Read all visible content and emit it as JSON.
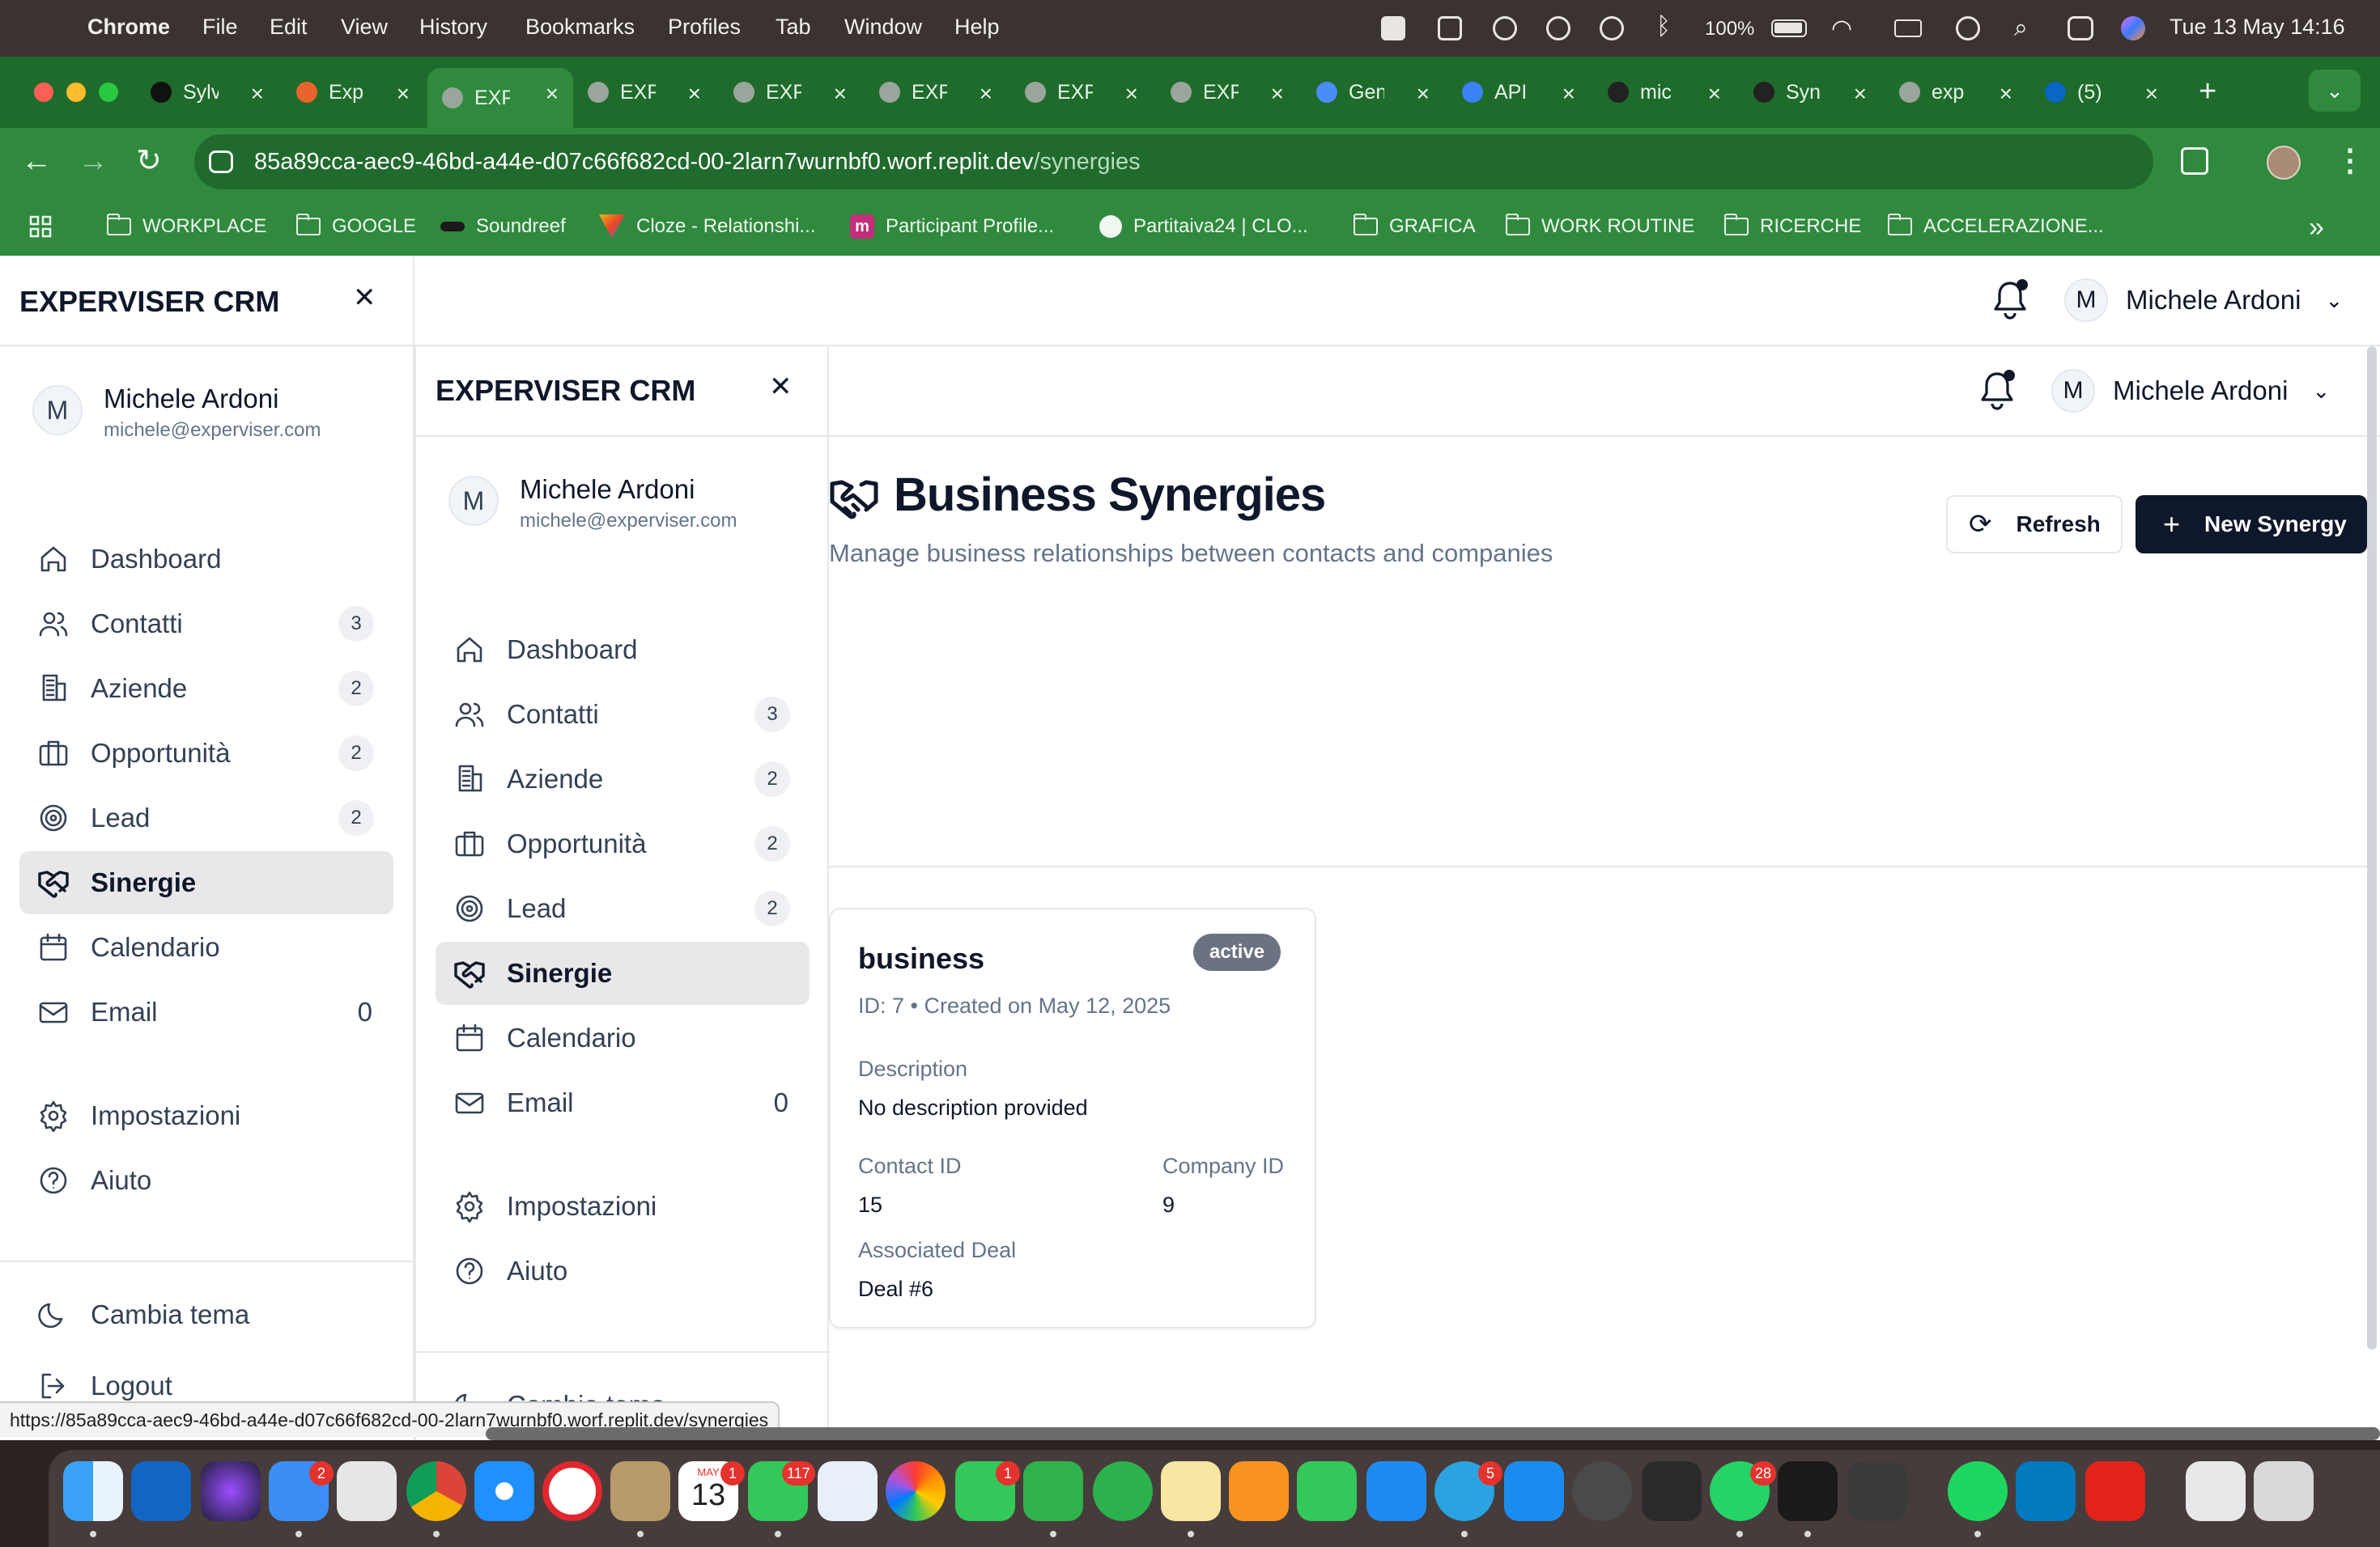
{
  "menubar": {
    "app": "Chrome",
    "menus": [
      "File",
      "Edit",
      "View",
      "History",
      "Bookmarks",
      "Profiles",
      "Tab",
      "Window",
      "Help"
    ],
    "battery": "100%",
    "clock": "Tue 13 May  14:16"
  },
  "tabs": [
    {
      "label": "Sylv",
      "color": "#111111"
    },
    {
      "label": "Exp",
      "color": "#e8642c"
    },
    {
      "label": "EXP",
      "color": "#9aa59c"
    },
    {
      "label": "EXP",
      "color": "#9aa59c"
    },
    {
      "label": "EXP",
      "color": "#9aa59c"
    },
    {
      "label": "EXP",
      "color": "#9aa59c"
    },
    {
      "label": "EXP",
      "color": "#9aa59c"
    },
    {
      "label": "EXP",
      "color": "#9aa59c"
    },
    {
      "label": "Gen",
      "color": "#4b8df8"
    },
    {
      "label": "API",
      "color": "#3b82f6"
    },
    {
      "label": "mic",
      "color": "#222222"
    },
    {
      "label": "Syn",
      "color": "#222222"
    },
    {
      "label": "exp",
      "color": "#9aa59c"
    },
    {
      "label": "(5)",
      "color": "#0a66c2"
    }
  ],
  "omnibox": {
    "host": "85a89cca-aec9-46bd-a44e-d07c66f682cd-00-2larn7wurnbf0.worf.replit.dev",
    "path": "/synergies"
  },
  "bookmarks": [
    {
      "label": "WORKPLACE",
      "type": "folder"
    },
    {
      "label": "GOOGLE",
      "type": "folder"
    },
    {
      "label": "Soundreef",
      "type": "site"
    },
    {
      "label": "Cloze - Relationshi...",
      "type": "site"
    },
    {
      "label": "Participant Profile...",
      "type": "site"
    },
    {
      "label": "Partitaiva24 | CLO...",
      "type": "site"
    },
    {
      "label": "GRAFICA",
      "type": "folder"
    },
    {
      "label": "WORK ROUTINE",
      "type": "folder"
    },
    {
      "label": "RICERCHE",
      "type": "folder"
    },
    {
      "label": "ACCELERAZIONE...",
      "type": "folder"
    }
  ],
  "app": {
    "brand": "EXPERVISER CRM",
    "user": {
      "name": "Michele Ardoni",
      "email": "michele@experviser.com",
      "initial": "M"
    },
    "nav": [
      {
        "label": "Dashboard",
        "icon": "home-icon",
        "badge": ""
      },
      {
        "label": "Contatti",
        "icon": "users-icon",
        "badge": "3"
      },
      {
        "label": "Aziende",
        "icon": "building-icon",
        "badge": "2"
      },
      {
        "label": "Opportunità",
        "icon": "briefcase-icon",
        "badge": "2"
      },
      {
        "label": "Lead",
        "icon": "target-icon",
        "badge": "2"
      },
      {
        "label": "Sinergie",
        "icon": "handshake-icon",
        "badge": "",
        "active": true
      },
      {
        "label": "Calendario",
        "icon": "calendar-icon",
        "badge": ""
      },
      {
        "label": "Email",
        "icon": "mail-icon",
        "count": "0"
      }
    ],
    "secondary_nav": [
      {
        "label": "Impostazioni",
        "icon": "gear-icon"
      },
      {
        "label": "Aiuto",
        "icon": "help-icon"
      }
    ],
    "footer_nav": [
      {
        "label": "Cambia tema",
        "icon": "moon-icon"
      },
      {
        "label": "Logout",
        "icon": "logout-icon"
      }
    ],
    "page": {
      "title": "Business Synergies",
      "subtitle": "Manage business relationships between contacts and companies",
      "refresh_label": "Refresh",
      "new_label": "New Synergy"
    },
    "card": {
      "title": "business",
      "status": "active",
      "meta": "ID: 7 • Created on May 12, 2025",
      "description_label": "Description",
      "description_value": "No description provided",
      "contact_label": "Contact ID",
      "contact_value": "15",
      "company_label": "Company ID",
      "company_value": "9",
      "deal_label": "Associated Deal",
      "deal_value": "Deal #6"
    }
  },
  "status_url": "https://85a89cca-aec9-46bd-a44e-d07c66f682cd-00-2larn7wurnbf0.worf.replit.dev/synergies",
  "dock": {
    "badges": {
      "mail": "2",
      "calendar": "1",
      "calendar_month": "MAY",
      "calendar_day": "13",
      "messages": "117",
      "facetime": "1",
      "telegram": "5",
      "whatsapp": "28"
    }
  },
  "colors": {
    "chrome_green": "#2f8a3d",
    "primary_button": "#0f172a",
    "active_nav": "#e8e8ea",
    "badge_active": "#6b7280"
  }
}
